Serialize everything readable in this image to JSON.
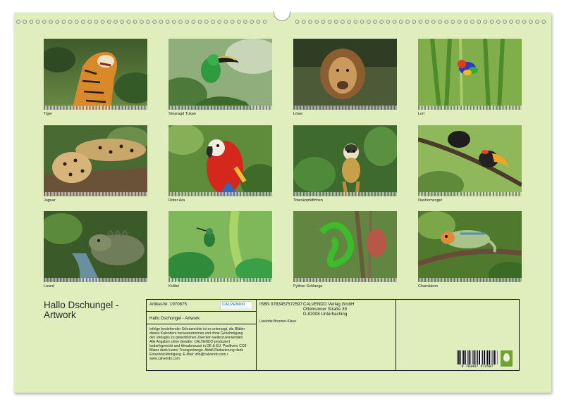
{
  "calendar": {
    "title_line1": "Hallo Dschungel -",
    "title_line2": "Artwork",
    "months": [
      {
        "label": "Tiger"
      },
      {
        "label": "Smaragd Tukan"
      },
      {
        "label": "Löwe"
      },
      {
        "label": "Lori"
      },
      {
        "label": "Jaguar"
      },
      {
        "label": "Roter Ara"
      },
      {
        "label": "Totenkopfäffchen"
      },
      {
        "label": "Nashornvogel"
      },
      {
        "label": "Lizard"
      },
      {
        "label": "Kolibri"
      },
      {
        "label": "Python Schlange"
      },
      {
        "label": "Chamäleon"
      }
    ]
  },
  "imprint": {
    "article_no": "Artikel-Nr. 1970875",
    "product_title": "Hallo Dschungel - Artwork",
    "legal_text": "Infolge bestehender Schutzrechte ist es untersagt, die Blätter dieses Kalenders herauszutrennen und ohne Genehmigung des Verlages zu gewerblichen Zwecken weiterzuverwenden. Alle Angaben ohne Gewähr. CALVENDO produziert bedarfsgerecht und klimabewusst in DE & EU. Positivere CO2-Bilanz dank kurzer Transportwege. Abfall-Reduzierung dank Einzelstückfertigung. E-Mail: info@calvendo.com • www.calvendo.com",
    "logo_text": "CALVENDO",
    "isbn": "ISBN 9783457572597",
    "author": "Liselotte Brunner-Klaus",
    "publisher_name": "CALVENDO Verlag GmbH",
    "publisher_street": "Ottobrunner Straße 39",
    "publisher_city": "D-82008 Unterhaching",
    "barcode_number": "9 783457 572597"
  }
}
